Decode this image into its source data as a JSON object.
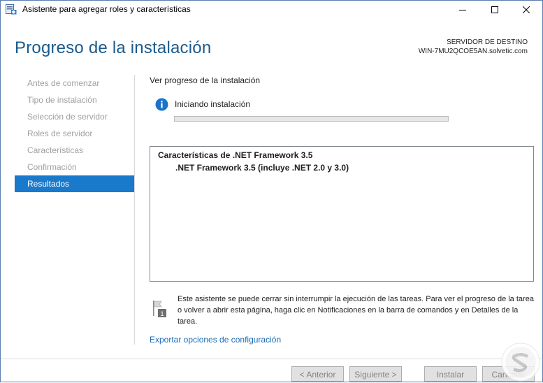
{
  "window": {
    "title": "Asistente para agregar roles y características",
    "minimize_label": "—",
    "maximize_label": "☐",
    "close_label": "✕"
  },
  "header": {
    "page_title": "Progreso de la instalación",
    "destination_label": "SERVIDOR DE DESTINO",
    "destination_server": "WIN-7MU2QCOE5AN.solvetic.com"
  },
  "sidebar": {
    "items": [
      {
        "label": "Antes de comenzar",
        "active": false
      },
      {
        "label": "Tipo de instalación",
        "active": false
      },
      {
        "label": "Selección de servidor",
        "active": false
      },
      {
        "label": "Roles de servidor",
        "active": false
      },
      {
        "label": "Características",
        "active": false
      },
      {
        "label": "Confirmación",
        "active": false
      },
      {
        "label": "Resultados",
        "active": true
      }
    ]
  },
  "main": {
    "section_heading": "Ver progreso de la instalación",
    "status_text": "Iniciando instalación",
    "status_icon": "info-icon",
    "progress_fraction": 0.0,
    "features": {
      "group": "Características de .NET Framework 3.5",
      "item": ".NET Framework 3.5 (incluye .NET 2.0 y 3.0)"
    },
    "note_icon_badge": "1",
    "note": "Este asistente se puede cerrar sin interrumpir la ejecución de las tareas. Para ver el progreso de la tarea o volver a abrir esta página, haga clic en Notificaciones en la barra de comandos y en Detalles de la tarea.",
    "export_link": "Exportar opciones de configuración"
  },
  "footer": {
    "previous": "< Anterior",
    "next": "Siguiente >",
    "install": "Instalar",
    "cancel": "Cancelar"
  },
  "colors": {
    "accent": "#1979ca",
    "title_blue": "#1a5a8c",
    "link_blue": "#1a6cb5",
    "disabled_text": "#a0a0a0"
  }
}
